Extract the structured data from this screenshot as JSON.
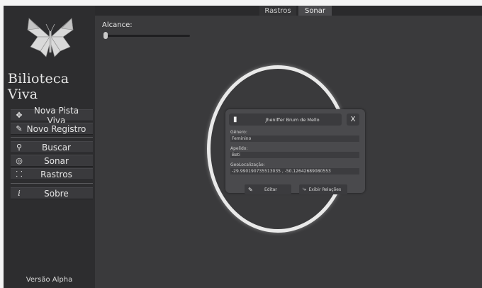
{
  "sidebar": {
    "brand": "Bilioteca Viva",
    "nav": [
      {
        "label": "Nova Pista Viva",
        "icon": "map-pin-icon"
      },
      {
        "label": "Novo Registro",
        "icon": "edit-icon"
      },
      {
        "label": "Buscar",
        "icon": "search-icon"
      },
      {
        "label": "Sonar",
        "icon": "sonar-icon"
      },
      {
        "label": "Rastros",
        "icon": "footprints-icon"
      },
      {
        "label": "Sobre",
        "icon": "info-icon"
      }
    ],
    "version": "Versão Alpha"
  },
  "tabs": [
    {
      "label": "Rastros"
    },
    {
      "label": "Sonar",
      "active": true
    }
  ],
  "sonar": {
    "range_label": "Alcance:",
    "range_value": 0.0
  },
  "card": {
    "name": "Jheniffer Brum de Mello",
    "close_label": "X",
    "fields": [
      {
        "label": "Gênero:",
        "value": "Feminino"
      },
      {
        "label": "Apelido:",
        "value": "Beti"
      },
      {
        "label": "GeoLocalização:",
        "value": "-29.990190735513035 , -50.12642689080553"
      }
    ],
    "edit_label": "Editar",
    "relations_label": "Exibir Relações"
  },
  "colors": {
    "sidebar_bg": "#2d2d2f",
    "main_bg": "#3a3a3c",
    "ring": "#e9e9e9"
  }
}
